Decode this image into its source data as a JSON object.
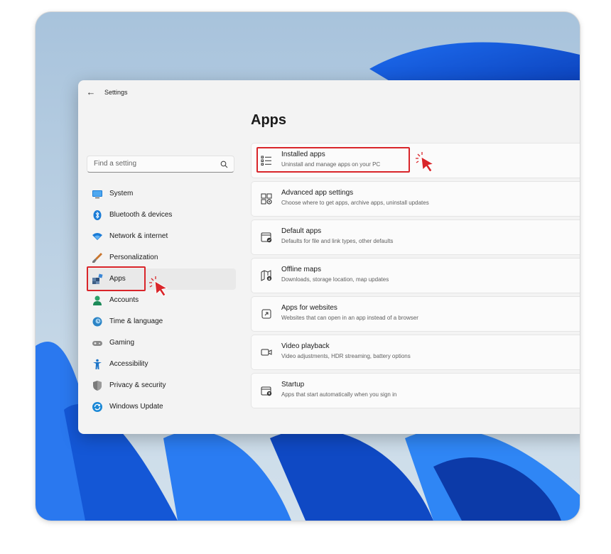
{
  "window": {
    "title": "Settings",
    "back_icon": "arrow-left-icon"
  },
  "search": {
    "placeholder": "Find a setting",
    "icon": "search-icon"
  },
  "sidebar": {
    "items": [
      {
        "label": "System",
        "icon": "system-icon",
        "color": "#0f6cbd"
      },
      {
        "label": "Bluetooth & devices",
        "icon": "bluetooth-icon",
        "color": "#0f6cbd"
      },
      {
        "label": "Network & internet",
        "icon": "wifi-icon",
        "color": "#0f6cbd"
      },
      {
        "label": "Personalization",
        "icon": "brush-icon",
        "color": "#d97b2c"
      },
      {
        "label": "Apps",
        "icon": "apps-icon",
        "color": "#3a6ea5",
        "active": true
      },
      {
        "label": "Accounts",
        "icon": "accounts-icon",
        "color": "#2aa36b"
      },
      {
        "label": "Time & language",
        "icon": "time-language-icon",
        "color": "#2b84c6"
      },
      {
        "label": "Gaming",
        "icon": "gaming-icon",
        "color": "#7a7a7a"
      },
      {
        "label": "Accessibility",
        "icon": "accessibility-icon",
        "color": "#1d74c7"
      },
      {
        "label": "Privacy & security",
        "icon": "shield-icon",
        "color": "#6d6d6d"
      },
      {
        "label": "Windows Update",
        "icon": "windows-update-icon",
        "color": "#1b88d6"
      }
    ]
  },
  "main": {
    "title": "Apps",
    "cards": [
      {
        "title": "Installed apps",
        "subtitle": "Uninstall and manage apps on your PC",
        "icon": "list-icon"
      },
      {
        "title": "Advanced app settings",
        "subtitle": "Choose where to get apps, archive apps, uninstall updates",
        "icon": "app-settings-icon"
      },
      {
        "title": "Default apps",
        "subtitle": "Defaults for file and link types, other defaults",
        "icon": "default-apps-icon"
      },
      {
        "title": "Offline maps",
        "subtitle": "Downloads, storage location, map updates",
        "icon": "map-icon"
      },
      {
        "title": "Apps for websites",
        "subtitle": "Websites that can open in an app instead of a browser",
        "icon": "open-in-app-icon"
      },
      {
        "title": "Video playback",
        "subtitle": "Video adjustments, HDR streaming, battery options",
        "icon": "video-icon"
      },
      {
        "title": "Startup",
        "subtitle": "Apps that start automatically when you sign in",
        "icon": "startup-icon"
      }
    ]
  },
  "colors": {
    "highlight": "#d9252a",
    "window_bg": "#f3f3f3",
    "card_bg": "#fbfbfb"
  }
}
